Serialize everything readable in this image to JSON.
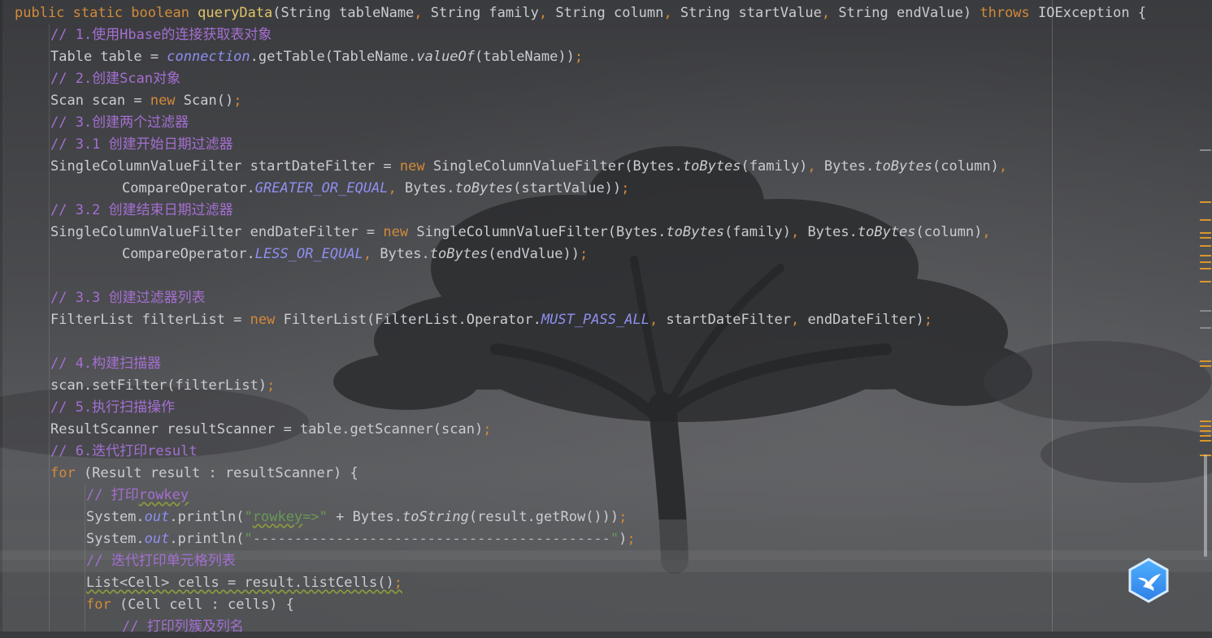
{
  "editor": {
    "lines": [
      {
        "indent": 0,
        "tokens": [
          {
            "t": "public static boolean ",
            "c": "kw"
          },
          {
            "t": "queryData",
            "c": "fn"
          },
          {
            "t": "(String tableName",
            "c": "tx"
          },
          {
            "t": ",",
            "c": "kw"
          },
          {
            "t": " String family",
            "c": "tx"
          },
          {
            "t": ",",
            "c": "kw"
          },
          {
            "t": " String column",
            "c": "tx"
          },
          {
            "t": ",",
            "c": "kw"
          },
          {
            "t": " String startValue",
            "c": "tx"
          },
          {
            "t": ",",
            "c": "kw"
          },
          {
            "t": " String endValue) ",
            "c": "tx"
          },
          {
            "t": "throws",
            "c": "kw"
          },
          {
            "t": " IOException {",
            "c": "tx"
          }
        ]
      },
      {
        "indent": 1,
        "tokens": [
          {
            "t": "// 1.使用Hbase的连接获取表对象",
            "c": "cm"
          }
        ]
      },
      {
        "indent": 1,
        "tokens": [
          {
            "t": "Table table = ",
            "c": "tx"
          },
          {
            "t": "connection",
            "c": "fld"
          },
          {
            "t": ".getTable(TableName.",
            "c": "tx"
          },
          {
            "t": "valueOf",
            "c": "sm"
          },
          {
            "t": "(tableName))",
            "c": "tx"
          },
          {
            "t": ";",
            "c": "kw"
          }
        ]
      },
      {
        "indent": 1,
        "tokens": [
          {
            "t": "// 2.创建Scan对象",
            "c": "cm"
          }
        ]
      },
      {
        "indent": 1,
        "tokens": [
          {
            "t": "Scan scan = ",
            "c": "tx"
          },
          {
            "t": "new",
            "c": "kw"
          },
          {
            "t": " Scan()",
            "c": "tx"
          },
          {
            "t": ";",
            "c": "kw"
          }
        ]
      },
      {
        "indent": 1,
        "tokens": [
          {
            "t": "// 3.创建两个过滤器",
            "c": "cm"
          }
        ]
      },
      {
        "indent": 1,
        "tokens": [
          {
            "t": "// 3.1 创建开始日期过滤器",
            "c": "cm"
          }
        ]
      },
      {
        "indent": 1,
        "tokens": [
          {
            "t": "SingleColumnValueFilter startDateFilter = ",
            "c": "tx"
          },
          {
            "t": "new",
            "c": "kw"
          },
          {
            "t": " SingleColumnValueFilter(Bytes.",
            "c": "tx"
          },
          {
            "t": "toBytes",
            "c": "sm"
          },
          {
            "t": "(family)",
            "c": "tx"
          },
          {
            "t": ",",
            "c": "kw"
          },
          {
            "t": " Bytes.",
            "c": "tx"
          },
          {
            "t": "toBytes",
            "c": "sm"
          },
          {
            "t": "(column)",
            "c": "tx"
          },
          {
            "t": ",",
            "c": "kw"
          }
        ]
      },
      {
        "indent": 3,
        "tokens": [
          {
            "t": "CompareOperator.",
            "c": "tx"
          },
          {
            "t": "GREATER_OR_EQUAL",
            "c": "fld"
          },
          {
            "t": ",",
            "c": "kw"
          },
          {
            "t": " Bytes.",
            "c": "tx"
          },
          {
            "t": "toBytes",
            "c": "sm"
          },
          {
            "t": "(startValue))",
            "c": "tx"
          },
          {
            "t": ";",
            "c": "kw"
          }
        ]
      },
      {
        "indent": 1,
        "tokens": [
          {
            "t": "// 3.2 创建结束日期过滤器",
            "c": "cm"
          }
        ]
      },
      {
        "indent": 1,
        "tokens": [
          {
            "t": "SingleColumnValueFilter endDateFilter = ",
            "c": "tx"
          },
          {
            "t": "new",
            "c": "kw"
          },
          {
            "t": " SingleColumnValueFilter(Bytes.",
            "c": "tx"
          },
          {
            "t": "toBytes",
            "c": "sm"
          },
          {
            "t": "(family)",
            "c": "tx"
          },
          {
            "t": ",",
            "c": "kw"
          },
          {
            "t": " Bytes.",
            "c": "tx"
          },
          {
            "t": "toBytes",
            "c": "sm"
          },
          {
            "t": "(column)",
            "c": "tx"
          },
          {
            "t": ",",
            "c": "kw"
          }
        ]
      },
      {
        "indent": 3,
        "tokens": [
          {
            "t": "CompareOperator.",
            "c": "tx"
          },
          {
            "t": "LESS_OR_EQUAL",
            "c": "fld"
          },
          {
            "t": ",",
            "c": "kw"
          },
          {
            "t": " Bytes.",
            "c": "tx"
          },
          {
            "t": "toBytes",
            "c": "sm"
          },
          {
            "t": "(endValue))",
            "c": "tx"
          },
          {
            "t": ";",
            "c": "kw"
          }
        ]
      },
      {
        "indent": 0,
        "tokens": []
      },
      {
        "indent": 1,
        "tokens": [
          {
            "t": "// 3.3 创建过滤器列表",
            "c": "cm"
          }
        ]
      },
      {
        "indent": 1,
        "tokens": [
          {
            "t": "FilterList filterList = ",
            "c": "tx"
          },
          {
            "t": "new",
            "c": "kw"
          },
          {
            "t": " FilterList(FilterList.Operator.",
            "c": "tx"
          },
          {
            "t": "MUST_PASS_ALL",
            "c": "fld"
          },
          {
            "t": ",",
            "c": "kw"
          },
          {
            "t": " startDateFilter",
            "c": "tx"
          },
          {
            "t": ",",
            "c": "kw"
          },
          {
            "t": " endDateFilter)",
            "c": "tx"
          },
          {
            "t": ";",
            "c": "kw"
          }
        ]
      },
      {
        "indent": 0,
        "tokens": []
      },
      {
        "indent": 1,
        "tokens": [
          {
            "t": "// 4.构建扫描器",
            "c": "cm"
          }
        ]
      },
      {
        "indent": 1,
        "tokens": [
          {
            "t": "scan.setFilter(filterList)",
            "c": "tx"
          },
          {
            "t": ";",
            "c": "kw"
          }
        ]
      },
      {
        "indent": 1,
        "tokens": [
          {
            "t": "// 5.执行扫描操作",
            "c": "cm"
          }
        ]
      },
      {
        "indent": 1,
        "tokens": [
          {
            "t": "ResultScanner resultScanner = table.getScanner(scan)",
            "c": "tx"
          },
          {
            "t": ";",
            "c": "kw"
          }
        ]
      },
      {
        "indent": 1,
        "tokens": [
          {
            "t": "// 6.迭代打印result",
            "c": "cm"
          }
        ]
      },
      {
        "indent": 1,
        "tokens": [
          {
            "t": "for",
            "c": "kw"
          },
          {
            "t": " (Result result : resultScanner) {",
            "c": "tx"
          }
        ]
      },
      {
        "indent": 2,
        "tokens": [
          {
            "t": "// 打印",
            "c": "cm"
          },
          {
            "t": "rowkey",
            "c": "cm",
            "wavy": true
          }
        ]
      },
      {
        "indent": 2,
        "tokens": [
          {
            "t": "System.",
            "c": "tx"
          },
          {
            "t": "out",
            "c": "fld"
          },
          {
            "t": ".println(",
            "c": "tx"
          },
          {
            "t": "\"",
            "c": "str"
          },
          {
            "t": "rowkey",
            "c": "str",
            "wavy": true
          },
          {
            "t": "=>\"",
            "c": "str"
          },
          {
            "t": " + Bytes.",
            "c": "tx"
          },
          {
            "t": "toString",
            "c": "sm"
          },
          {
            "t": "(result.getRow()))",
            "c": "tx"
          },
          {
            "t": ";",
            "c": "kw"
          }
        ]
      },
      {
        "indent": 2,
        "tokens": [
          {
            "t": "System.",
            "c": "tx"
          },
          {
            "t": "out",
            "c": "fld"
          },
          {
            "t": ".println(",
            "c": "tx"
          },
          {
            "t": "\"",
            "c": "str"
          },
          {
            "t": "-------------------------------------------",
            "c": "strdash"
          },
          {
            "t": "\"",
            "c": "str"
          },
          {
            "t": ")",
            "c": "tx"
          },
          {
            "t": ";",
            "c": "kw"
          }
        ]
      },
      {
        "indent": 2,
        "current": true,
        "tokens": [
          {
            "t": "// 迭代打印单元格列表",
            "c": "cm"
          }
        ]
      },
      {
        "indent": 2,
        "tokens": [
          {
            "t": "List<Cell> cells = result.listCells()",
            "c": "tx",
            "wavy": true
          },
          {
            "t": ";",
            "c": "kw",
            "wavy": true
          }
        ]
      },
      {
        "indent": 2,
        "tokens": [
          {
            "t": "for",
            "c": "kw"
          },
          {
            "t": " (Cell cell : cells) {",
            "c": "tx"
          }
        ]
      },
      {
        "indent": 3,
        "tokens": [
          {
            "t": "// 打印列簇及列名",
            "c": "cm"
          }
        ]
      }
    ]
  },
  "colors": {
    "keyword": "#d38a3a",
    "comment": "#a46fd1",
    "field": "#8f8ff0",
    "string": "#6a9a55",
    "function_decl": "#e0c36a",
    "text": "#c9ccd1",
    "marker": "#d9962d"
  },
  "assistant": {
    "icon": "bird-assistant-icon"
  }
}
